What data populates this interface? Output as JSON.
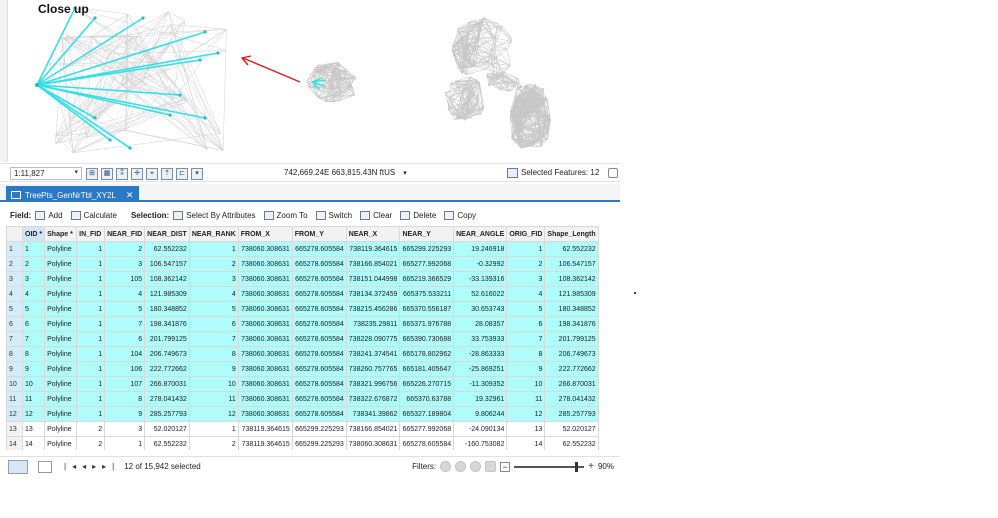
{
  "map": {
    "closeup_label": "Close up",
    "scale": "1:11,827",
    "coordinates": "742,669.24E 663,815.43N ftUS",
    "selected_features": "Selected Features: 12",
    "colors": {
      "highlight": "#33e0e8",
      "arrow": "#e01818",
      "network": "#c8c8c8"
    }
  },
  "table": {
    "tab_title": "TreePts_GenNrTbl_XY2L",
    "toolbar": {
      "field_label": "Field:",
      "add": "Add",
      "calculate": "Calculate",
      "selection_label": "Selection:",
      "select_by_attributes": "Select By Attributes",
      "zoom_to": "Zoom To",
      "switch": "Switch",
      "clear": "Clear",
      "delete": "Delete",
      "copy": "Copy"
    },
    "columns": [
      "OID *",
      "Shape *",
      "IN_FID",
      "NEAR_FID",
      "NEAR_DIST",
      "NEAR_RANK",
      "FROM_X",
      "FROM_Y",
      "NEAR_X",
      "NEAR_Y",
      "NEAR_ANGLE",
      "ORIG_FID",
      "Shape_Length"
    ],
    "rows": [
      {
        "n": "1",
        "oid": "1",
        "shape": "Polyline",
        "in_fid": "1",
        "near_fid": "2",
        "near_dist": "62.552232",
        "near_rank": "1",
        "from_x": "738060.308631",
        "from_y": "665278.605584",
        "near_x": "738119.364615",
        "near_y": "665299.225293",
        "near_angle": "19.246918",
        "orig_fid": "1",
        "shape_length": "62.552232",
        "selected": true
      },
      {
        "n": "2",
        "oid": "2",
        "shape": "Polyline",
        "in_fid": "1",
        "near_fid": "3",
        "near_dist": "106.547157",
        "near_rank": "2",
        "from_x": "738060.308631",
        "from_y": "665278.605584",
        "near_x": "738166.854021",
        "near_y": "665277.992068",
        "near_angle": "-0.32992",
        "orig_fid": "2",
        "shape_length": "106.547157",
        "selected": true
      },
      {
        "n": "3",
        "oid": "3",
        "shape": "Polyline",
        "in_fid": "1",
        "near_fid": "105",
        "near_dist": "108.362142",
        "near_rank": "3",
        "from_x": "738060.308631",
        "from_y": "665278.605584",
        "near_x": "738151.044998",
        "near_y": "665219.366529",
        "near_angle": "-33.139316",
        "orig_fid": "3",
        "shape_length": "108.362142",
        "selected": true
      },
      {
        "n": "4",
        "oid": "4",
        "shape": "Polyline",
        "in_fid": "1",
        "near_fid": "4",
        "near_dist": "121.985309",
        "near_rank": "4",
        "from_x": "738060.308631",
        "from_y": "665278.605584",
        "near_x": "738134.372459",
        "near_y": "665375.533211",
        "near_angle": "52.616022",
        "orig_fid": "4",
        "shape_length": "121.985309",
        "selected": true
      },
      {
        "n": "5",
        "oid": "5",
        "shape": "Polyline",
        "in_fid": "1",
        "near_fid": "5",
        "near_dist": "180.348852",
        "near_rank": "5",
        "from_x": "738060.308631",
        "from_y": "665278.605584",
        "near_x": "738215.456286",
        "near_y": "665370.556187",
        "near_angle": "30.653743",
        "orig_fid": "5",
        "shape_length": "180.348852",
        "selected": true
      },
      {
        "n": "6",
        "oid": "6",
        "shape": "Polyline",
        "in_fid": "1",
        "near_fid": "7",
        "near_dist": "198.341876",
        "near_rank": "6",
        "from_x": "738060.308631",
        "from_y": "665278.605584",
        "near_x": "738235.29811",
        "near_y": "665371.976788",
        "near_angle": "28.08357",
        "orig_fid": "6",
        "shape_length": "198.341876",
        "selected": true
      },
      {
        "n": "7",
        "oid": "7",
        "shape": "Polyline",
        "in_fid": "1",
        "near_fid": "6",
        "near_dist": "201.799125",
        "near_rank": "7",
        "from_x": "738060.308631",
        "from_y": "665278.605584",
        "near_x": "738228.090775",
        "near_y": "665390.730688",
        "near_angle": "33.753933",
        "orig_fid": "7",
        "shape_length": "201.799125",
        "selected": true
      },
      {
        "n": "8",
        "oid": "8",
        "shape": "Polyline",
        "in_fid": "1",
        "near_fid": "104",
        "near_dist": "206.749673",
        "near_rank": "8",
        "from_x": "738060.308631",
        "from_y": "665278.605584",
        "near_x": "738241.374541",
        "near_y": "665178.802962",
        "near_angle": "-28.863333",
        "orig_fid": "8",
        "shape_length": "206.749673",
        "selected": true
      },
      {
        "n": "9",
        "oid": "9",
        "shape": "Polyline",
        "in_fid": "1",
        "near_fid": "106",
        "near_dist": "222.772662",
        "near_rank": "9",
        "from_x": "738060.308631",
        "from_y": "665278.605584",
        "near_x": "738260.757765",
        "near_y": "665181.405647",
        "near_angle": "-25.869251",
        "orig_fid": "9",
        "shape_length": "222.772662",
        "selected": true
      },
      {
        "n": "10",
        "oid": "10",
        "shape": "Polyline",
        "in_fid": "1",
        "near_fid": "107",
        "near_dist": "266.870031",
        "near_rank": "10",
        "from_x": "738060.308631",
        "from_y": "665278.605584",
        "near_x": "738321.996756",
        "near_y": "665226.270715",
        "near_angle": "-11.309352",
        "orig_fid": "10",
        "shape_length": "266.870031",
        "selected": true
      },
      {
        "n": "11",
        "oid": "11",
        "shape": "Polyline",
        "in_fid": "1",
        "near_fid": "8",
        "near_dist": "278.041432",
        "near_rank": "11",
        "from_x": "738060.308631",
        "from_y": "665278.605584",
        "near_x": "738322.676872",
        "near_y": "665370.63788",
        "near_angle": "19.32961",
        "orig_fid": "11",
        "shape_length": "278.041432",
        "selected": true
      },
      {
        "n": "12",
        "oid": "12",
        "shape": "Polyline",
        "in_fid": "1",
        "near_fid": "9",
        "near_dist": "285.257793",
        "near_rank": "12",
        "from_x": "738060.308631",
        "from_y": "665278.605584",
        "near_x": "738341.39862",
        "near_y": "665327.189804",
        "near_angle": "9.806244",
        "orig_fid": "12",
        "shape_length": "285.257793",
        "selected": true
      },
      {
        "n": "13",
        "oid": "13",
        "shape": "Polyline",
        "in_fid": "2",
        "near_fid": "3",
        "near_dist": "52.020127",
        "near_rank": "1",
        "from_x": "738119.364615",
        "from_y": "665299.225293",
        "near_x": "738166.854021",
        "near_y": "665277.992068",
        "near_angle": "-24.090134",
        "orig_fid": "13",
        "shape_length": "52.020127",
        "selected": false
      },
      {
        "n": "14",
        "oid": "14",
        "shape": "Polyline",
        "in_fid": "2",
        "near_fid": "1",
        "near_dist": "62.552232",
        "near_rank": "2",
        "from_x": "738119.364615",
        "from_y": "665299.225293",
        "near_x": "738060.308631",
        "near_y": "665278.605584",
        "near_angle": "-160.753082",
        "orig_fid": "14",
        "shape_length": "62.552232",
        "selected": false
      }
    ],
    "status": {
      "selection_count": "12 of 15,942 selected",
      "filters_label": "Filters:",
      "zoom_percent": "90%",
      "zoom_level": 0.9
    }
  }
}
